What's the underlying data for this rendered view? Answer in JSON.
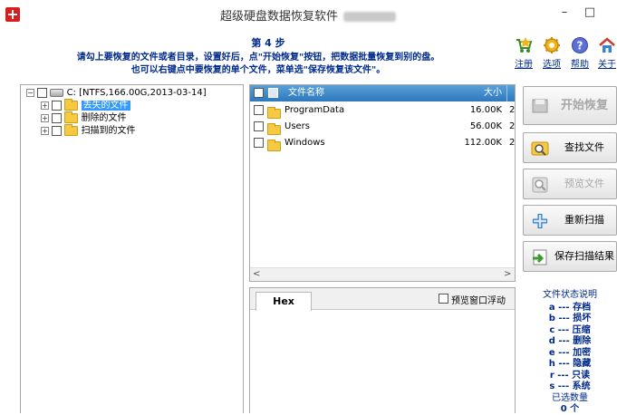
{
  "window": {
    "title": "超级硬盘数据恢复软件",
    "controls": {
      "minimize": "–",
      "maximize": "□"
    }
  },
  "instructions": {
    "step": "第 4 步",
    "line1": "请勾上要恢复的文件或者目录，设置好后，点\"开始恢复\"按钮，把数据批量恢复到别的盘。",
    "line2": "也可以右键点中要恢复的单个文件，菜单选\"保存恢复该文件\"。"
  },
  "toolbar": [
    {
      "label": "注册",
      "icon": "register-cart-icon"
    },
    {
      "label": "选项",
      "icon": "options-gear-icon"
    },
    {
      "label": "帮助",
      "icon": "help-icon"
    },
    {
      "label": "关于",
      "icon": "about-home-icon"
    }
  ],
  "tree": {
    "root": {
      "label": "C:  [NTFS,166.00G,2013-03-14]",
      "expander": "−"
    },
    "children": [
      {
        "label": "丢失的文件",
        "expander": "+",
        "selected": true
      },
      {
        "label": "删除的文件",
        "expander": "+",
        "selected": false
      },
      {
        "label": "扫描到的文件",
        "expander": "+",
        "selected": false
      }
    ]
  },
  "file_list": {
    "columns": {
      "name": "文件名称",
      "size": "大小"
    },
    "rows": [
      {
        "name": "ProgramData",
        "size": "16.00K",
        "extra": "2"
      },
      {
        "name": "Users",
        "size": "56.00K",
        "extra": "2"
      },
      {
        "name": "Windows",
        "size": "112.00K",
        "extra": "2"
      }
    ],
    "scroll_left": "<",
    "scroll_right": ">"
  },
  "preview": {
    "tab": "Hex",
    "float_option": "预览窗口浮动"
  },
  "actions": [
    {
      "label": "开始恢复",
      "icon": "start-recovery-icon",
      "enabled": false
    },
    {
      "label": "查找文件",
      "icon": "find-file-icon",
      "enabled": true
    },
    {
      "label": "预览文件",
      "icon": "preview-file-icon",
      "enabled": false
    },
    {
      "label": "重新扫描",
      "icon": "rescan-plus-icon",
      "enabled": true
    },
    {
      "label": "保存扫描结果",
      "icon": "save-scan-icon",
      "enabled": true
    }
  ],
  "legend": {
    "title": "文件状态说明",
    "items": [
      "a --- 存档",
      "b --- 损坏",
      "c --- 压缩",
      "d --- 删除",
      "e --- 加密",
      "h --- 隐藏",
      "r --- 只读",
      "s --- 系统"
    ],
    "selected_label": "已选数量",
    "selected_count": "0 个"
  },
  "colors": {
    "instruction_text": "#002a8c",
    "header_blue": "#2d78bd",
    "selection": "#3399ff"
  }
}
